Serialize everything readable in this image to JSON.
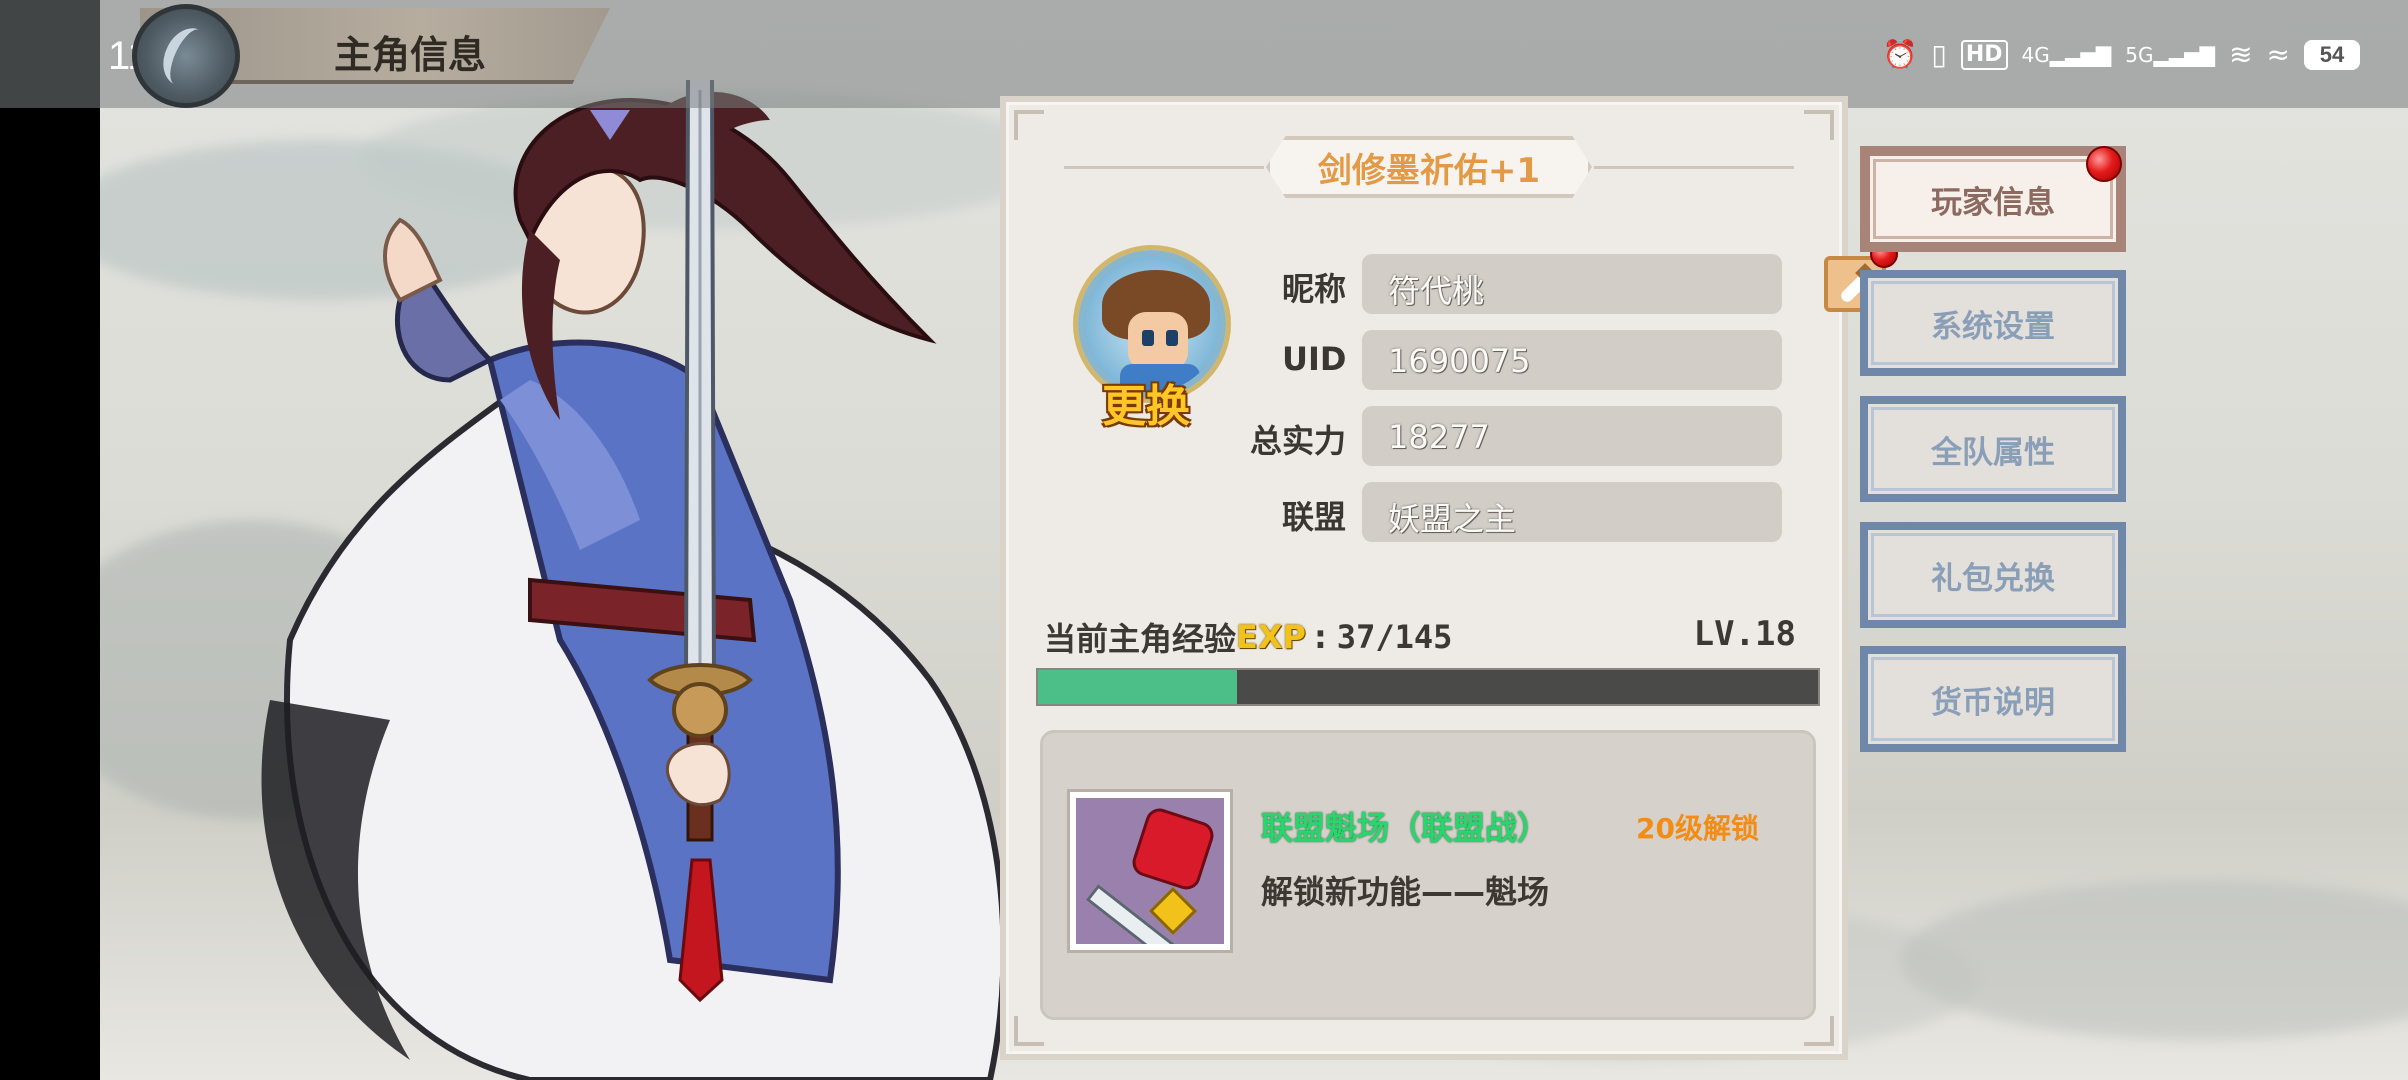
{
  "status_bar": {
    "time": "11:55",
    "left_icons": [
      "wechat-icon",
      "notification-badge-icon",
      "message-icon"
    ],
    "right_icons": [
      "alarm-icon",
      "vibrate-icon",
      "hd-icon",
      "4g-signal-icon",
      "5g-signal-icon",
      "hotspot-icon",
      "wifi-icon"
    ],
    "hd_text": "HD",
    "sig_4g": "4G",
    "sig_5g": "5G",
    "battery": "54"
  },
  "header": {
    "title": "主角信息"
  },
  "panel": {
    "buff_text": "剑修墨祈佑+1",
    "avatar_change_label": "更换",
    "fields": [
      {
        "label": "昵称",
        "value": "符代桃"
      },
      {
        "label": "UID",
        "value": "1690075"
      },
      {
        "label": "总实力",
        "value": "18277"
      },
      {
        "label": "联盟",
        "value": "妖盟之主"
      }
    ],
    "exp": {
      "label": "当前主角经验",
      "tag": "EXP",
      "colon": ":",
      "current": 37,
      "max": 145,
      "display": "37/145",
      "level": "LV.18"
    },
    "unlock": {
      "title": "联盟魁场（联盟战）",
      "requirement": "20级解锁",
      "description": "解锁新功能——魁场"
    }
  },
  "side_menu": [
    {
      "label": "玩家信息",
      "active": true,
      "has_red_dot": true
    },
    {
      "label": "系统设置",
      "active": false
    },
    {
      "label": "全队属性",
      "active": false
    },
    {
      "label": "礼包兑换",
      "active": false
    },
    {
      "label": "货币说明",
      "active": false
    }
  ],
  "colors": {
    "exp_fill": "#4cbf88",
    "unlock_title": "#2ad56c",
    "unlock_requirement": "#f28c14",
    "buff_text": "#e39a47",
    "menu_active": "#a88478",
    "menu_inactive": "#6f87a8"
  }
}
